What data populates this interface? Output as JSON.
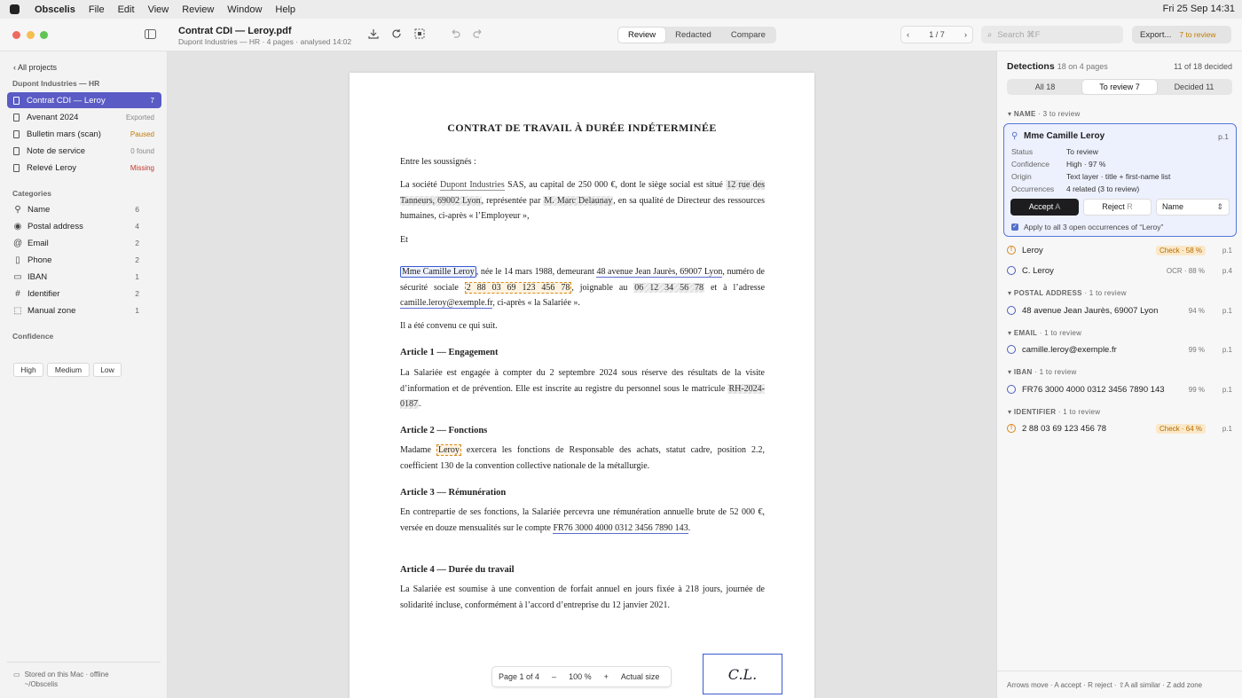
{
  "menubar": {
    "app": "Obscelis",
    "items": [
      "File",
      "Edit",
      "View",
      "Review",
      "Window",
      "Help"
    ],
    "clock": "Fri 25 Sep 14:31"
  },
  "toolbar": {
    "doc_title": "Contrat CDI — Leroy.pdf",
    "doc_sub": "Dupont Industries — HR · 4 pages · analysed 14:02",
    "modes": [
      "Review",
      "Redacted",
      "Compare"
    ],
    "page_indicator": "1 / 7",
    "search_placeholder": "Search  ⌘F",
    "export_label": "Export...",
    "export_badge": "7 to review"
  },
  "sidebar": {
    "back": "All projects",
    "group": "Dupont Industries — HR",
    "projects": [
      {
        "name": "Contrat CDI — Leroy",
        "status": "7"
      },
      {
        "name": "Avenant 2024",
        "status": "Exported"
      },
      {
        "name": "Bulletin mars (scan)",
        "status": "Paused"
      },
      {
        "name": "Note de service",
        "status": "0 found"
      },
      {
        "name": "Relevé Leroy",
        "status": "Missing"
      }
    ],
    "categories_label": "Categories",
    "categories": [
      {
        "name": "Name",
        "count": "6"
      },
      {
        "name": "Postal address",
        "count": "4"
      },
      {
        "name": "Email",
        "count": "2"
      },
      {
        "name": "Phone",
        "count": "2"
      },
      {
        "name": "IBAN",
        "count": "1"
      },
      {
        "name": "Identifier",
        "count": "2"
      },
      {
        "name": "Manual zone",
        "count": "1"
      }
    ],
    "confidence_label": "Confidence",
    "confidence": [
      "High",
      "Medium",
      "Low"
    ],
    "stored1": "Stored on this Mac · offline",
    "stored2": "~/Obscelis"
  },
  "colors": {
    "accent": "#5a5bc4",
    "status_paused": "#c27c00",
    "status_missing": "#c0392b",
    "check": "#d9861a"
  },
  "doc": {
    "title": "CONTRAT DE TRAVAIL À DURÉE INDÉTERMINÉE",
    "p1": "Entre les soussignés :",
    "p2a": "La société ",
    "p2b": "Dupont Industries",
    "p2c": " SAS, au capital de 250 000 €, dont le siège social est situé ",
    "p2d": "12 rue des Tanneurs, 69002 Lyon",
    "p2e": ", représentée par ",
    "p2f": "M. Marc Delaunay",
    "p2g": ", en sa qualité de Directeur des ressources humaines, ci-après « l’Employeur »,",
    "p3": "Et",
    "p4a": "Mme Camille Leroy",
    "p4b": ", née le 14 mars 1988, demeurant ",
    "p4c": "48 avenue Jean Jaurès, 69007 Lyon",
    "p4d": ", numéro de sécurité sociale ",
    "p4e": "2 88 03 69 123 456 78",
    "p4f": ", joignable au ",
    "p4g": "06 12 34 56 78",
    "p4h": " et à l’adresse ",
    "p4i": "camille.leroy@exemple.fr",
    "p4j": ", ci-après « la Salariée ».",
    "p5": "Il a été convenu ce qui suit.",
    "a1": "Article 1 — Engagement",
    "a1pa": "La Salariée est engagée à compter du 2 septembre 2024 sous réserve des résultats de la visite d’information et de prévention. Elle est inscrite au registre du personnel sous le matricule ",
    "a1pb": "RH-2024-0187",
    "a1pc": ".",
    "a2": "Article 2 — Fonctions",
    "a2pa": "Madame ",
    "a2pb": "Leroy",
    "a2pc": " exercera les fonctions de Responsable des achats, statut cadre, position 2.2, coefficient 130 de la convention collective nationale de la métallurgie.",
    "a3": "Article 3 — Rémunération",
    "a3pa": "En contrepartie de ses fonctions, la Salariée percevra une rémunération annuelle brute de 52 000 €, versée en douze mensualités sur le compte ",
    "a3pb": "FR76 3000 4000 0312 3456 7890 143",
    "a3pc": ".",
    "a4": "Article 4 — Durée du travail",
    "a4p": "La Salariée est soumise à une convention de forfait annuel en jours fixée à 218 jours, journée de solidarité incluse, conformément à l’accord d’entreprise du 12 janvier 2021.",
    "signature": "C.L.",
    "zoom": {
      "page": "Page 1 of 4",
      "minus": "–",
      "pct": "100 %",
      "plus": "+",
      "actual": "Actual size"
    }
  },
  "detections": {
    "title": "Detections",
    "sub": "18 on 4 pages",
    "decided": "11 of 18 decided",
    "tabs": [
      "All 18",
      "To review 7",
      "Decided 11"
    ],
    "sec_name": "NAME",
    "sec_name_sub": " · 3 to review",
    "card": {
      "name": "Mme Camille Leroy",
      "page": "p.1",
      "status_k": "Status",
      "status_v": "To review",
      "conf_k": "Confidence",
      "conf_v": "High · 97 %",
      "origin_k": "Origin",
      "origin_v": "Text layer · title + first-name list",
      "occ_k": "Occurrences",
      "occ_v": "4 related (3 to review)",
      "accept": "Accept",
      "accept_key": "A",
      "reject": "Reject",
      "reject_key": "R",
      "select": "Name",
      "apply": "Apply to all 3 open occurrences of “Leroy”"
    },
    "name_items": [
      {
        "text": "Leroy",
        "badge": "Check · 58 %",
        "page": "p.1"
      },
      {
        "text": "C. Leroy",
        "conf": "OCR · 88 %",
        "page": "p.4"
      }
    ],
    "sec_addr": "POSTAL ADDRESS",
    "sec_addr_sub": " · 1 to review",
    "addr": {
      "text": "48 avenue Jean Jaurès, 69007 Lyon",
      "conf": "94 %",
      "page": "p.1"
    },
    "sec_email": "EMAIL",
    "sec_email_sub": " · 1 to review",
    "email": {
      "text": "camille.leroy@exemple.fr",
      "conf": "99 %",
      "page": "p.1"
    },
    "sec_iban": "IBAN",
    "sec_iban_sub": " · 1 to review",
    "iban": {
      "text": "FR76 3000 4000 0312 3456 7890 143",
      "conf": "99 %",
      "page": "p.1"
    },
    "sec_id": "IDENTIFIER",
    "sec_id_sub": " · 1 to review",
    "ident": {
      "text": "2 88 03 69 123 456 78",
      "badge": "Check · 64 %",
      "page": "p.1"
    },
    "footer": "Arrows move · A accept · R reject · ⇧A all similar · Z add zone"
  }
}
